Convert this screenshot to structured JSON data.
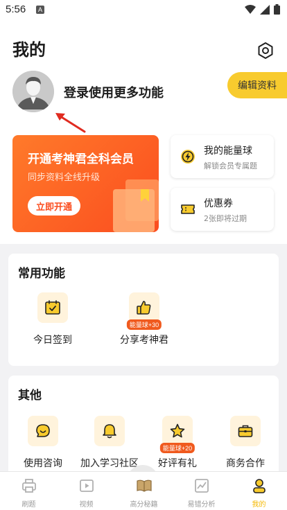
{
  "status": {
    "time": "5:56",
    "app_indicator": "A"
  },
  "header": {
    "title": "我的"
  },
  "profile": {
    "login_text": "登录使用更多功能",
    "edit_button": "编辑资料"
  },
  "vip": {
    "title": "开通考神君全科会员",
    "subtitle": "同步资料全线升级",
    "button": "立即开通"
  },
  "side_cards": [
    {
      "title": "我的能量球",
      "subtitle": "解锁会员专属题",
      "icon": "lightning-icon"
    },
    {
      "title": "优惠券",
      "subtitle": "2张即将过期",
      "icon": "ticket-icon"
    }
  ],
  "common": {
    "title": "常用功能",
    "items": [
      {
        "label": "今日签到",
        "icon": "calendar-check-icon",
        "badge": ""
      },
      {
        "label": "分享考神君",
        "icon": "thumbs-up-icon",
        "badge": "能量球+30"
      }
    ]
  },
  "other": {
    "title": "其他",
    "items": [
      {
        "label": "使用咨询",
        "icon": "chat-icon",
        "badge": ""
      },
      {
        "label": "加入学习社区",
        "icon": "bell-icon",
        "badge": ""
      },
      {
        "label": "好评有礼",
        "icon": "star-icon",
        "badge": "能量球+20"
      },
      {
        "label": "商务合作",
        "icon": "briefcase-icon",
        "badge": ""
      }
    ]
  },
  "tabs": [
    {
      "label": "刷题",
      "icon": "printer-icon",
      "active": false
    },
    {
      "label": "视频",
      "icon": "play-icon",
      "active": false
    },
    {
      "label": "高分秘籍",
      "icon": "book-icon",
      "active": false
    },
    {
      "label": "易错分析",
      "icon": "chart-icon",
      "active": false
    },
    {
      "label": "我的",
      "icon": "user-icon",
      "active": true
    }
  ],
  "colors": {
    "accent": "#f8cb2e",
    "vip_orange": "#fb4d1f",
    "active_tab": "#f5b800"
  }
}
